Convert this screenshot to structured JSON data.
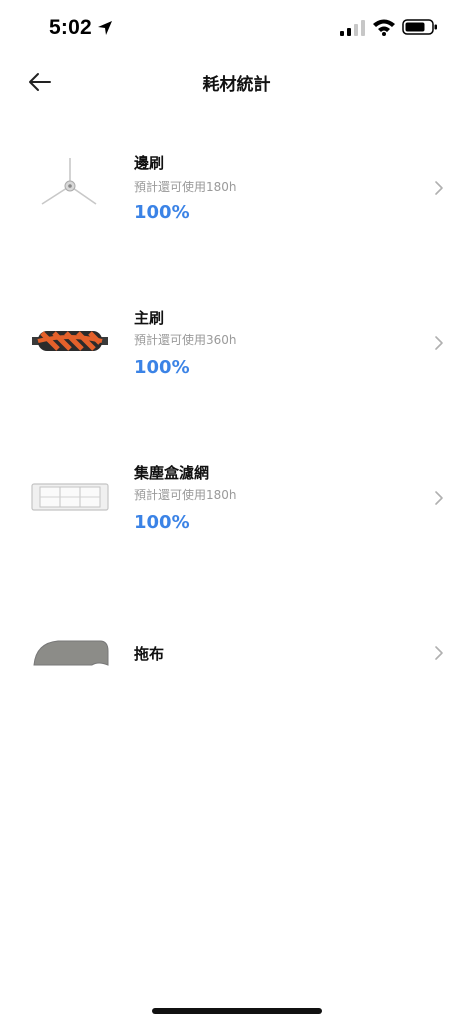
{
  "status_bar": {
    "time": "5:02"
  },
  "nav": {
    "title": "耗材統計"
  },
  "items": [
    {
      "name": "邊刷",
      "subtitle": "預計還可使用180h",
      "percent": "100%",
      "icon": "side-brush"
    },
    {
      "name": "主刷",
      "subtitle": "預計還可使用360h",
      "percent": "100%",
      "icon": "main-brush"
    },
    {
      "name": "集塵盒濾網",
      "subtitle": "預計還可使用180h",
      "percent": "100%",
      "icon": "dustbin-filter"
    },
    {
      "name": "拖布",
      "subtitle": "",
      "percent": "",
      "icon": "mop-pad"
    }
  ],
  "colors": {
    "accent": "#3b83e6",
    "subtitle": "#9a9a9a",
    "brush_orange": "#e4612b"
  }
}
